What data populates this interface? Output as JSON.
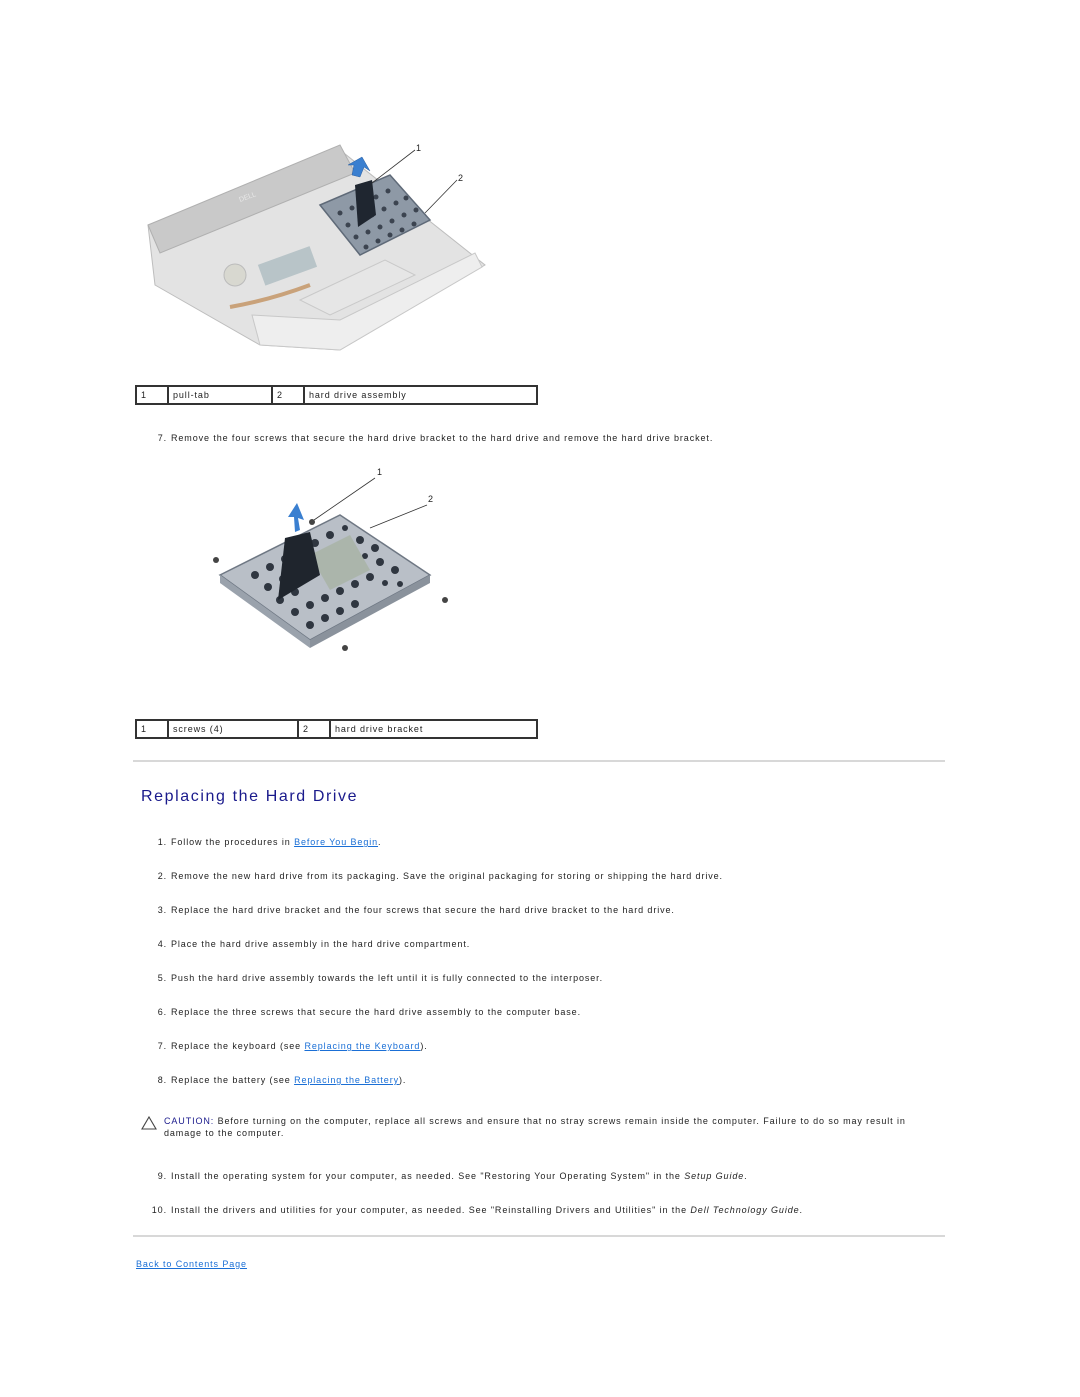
{
  "figure1": {
    "callouts": [
      "1",
      "2"
    ],
    "legend": [
      {
        "num": "1",
        "label": "pull-tab"
      },
      {
        "num": "2",
        "label": "hard drive assembly"
      }
    ],
    "brand_mark": "DELL"
  },
  "step7_removal": {
    "num": "7.",
    "text": "Remove the four screws that secure the hard drive bracket to the hard drive and remove the hard drive bracket."
  },
  "figure2": {
    "callouts": [
      "1",
      "2"
    ],
    "legend": [
      {
        "num": "1",
        "label": "screws (4)"
      },
      {
        "num": "2",
        "label": "hard drive bracket"
      }
    ]
  },
  "section": {
    "heading": "Replacing the Hard Drive",
    "heading_color": "#1a1a8c",
    "link_color": "#1a6fd6",
    "steps": [
      {
        "num": "1.",
        "pre": "Follow the procedures in ",
        "link": "Before You Begin",
        "post": "."
      },
      {
        "num": "2.",
        "text": "Remove the new hard drive from its packaging. Save the original packaging for storing or shipping the hard drive."
      },
      {
        "num": "3.",
        "text": "Replace the hard drive bracket and the four screws that secure the hard drive bracket to the hard drive."
      },
      {
        "num": "4.",
        "text": "Place the hard drive assembly in the hard drive compartment."
      },
      {
        "num": "5.",
        "text": "Push the hard drive assembly towards the left until it is fully connected to the interposer."
      },
      {
        "num": "6.",
        "text": "Replace the three screws that secure the hard drive assembly to the computer base."
      },
      {
        "num": "7.",
        "pre": "Replace the keyboard (see ",
        "link": "Replacing the Keyboard",
        "post": ")."
      },
      {
        "num": "8.",
        "pre": "Replace the battery (see ",
        "link": "Replacing the Battery",
        "post": ")."
      },
      {
        "num": "9.",
        "pre": "Install the operating system for your computer, as needed. See \"Restoring Your Operating System\" in the ",
        "italic": "Setup Guide",
        "post": "."
      },
      {
        "num": "10.",
        "pre": "Install the drivers and utilities for your computer, as needed. See \"Reinstalling Drivers and Utilities\" in the ",
        "italic": "Dell Technology Guide",
        "post": "."
      }
    ],
    "caution": {
      "icon": "caution-triangle-icon",
      "label": "CAUTION:",
      "text": " Before turning on the computer, replace all screws and ensure that no stray screws remain inside the computer. Failure to do so may result in damage to the computer."
    }
  },
  "footer": {
    "back_link": "Back to Contents Page"
  }
}
